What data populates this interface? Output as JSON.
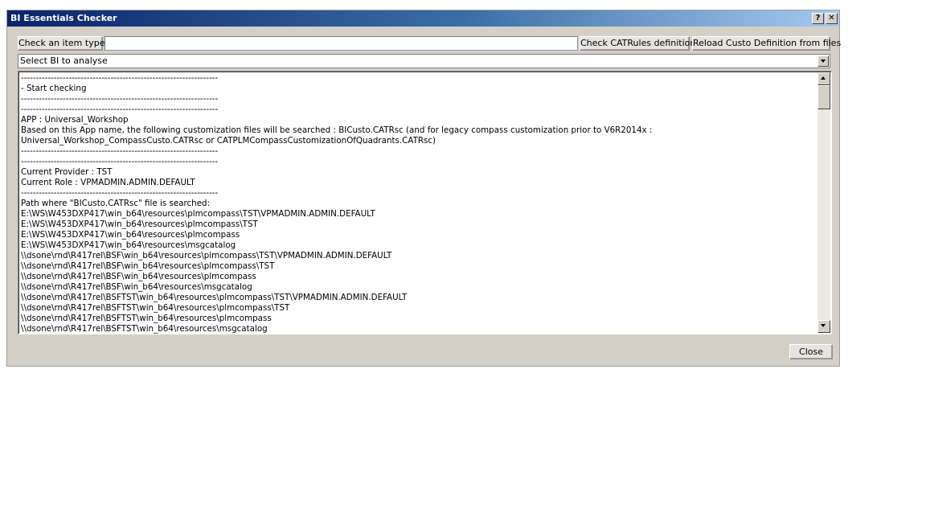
{
  "window": {
    "title": "BI Essentials Checker",
    "help_label": "?",
    "close_label": "✕"
  },
  "toolbar": {
    "check_item_type_label": "Check an item type",
    "item_type_value": "",
    "check_catrules_label": "Check CATRules definition",
    "reload_custo_label": "Reload Custo Definition from files"
  },
  "bi_select": {
    "value": "Select BI to analyse"
  },
  "log": {
    "lines": [
      "------------------------------------------------------------------",
      "- Start checking",
      "------------------------------------------------------------------",
      "------------------------------------------------------------------",
      "APP : Universal_Workshop",
      "Based on this App name, the following customization files will be searched : BICusto.CATRsc (and for legacy compass customization prior to V6R2014x : Universal_Workshop_CompassCusto.CATRsc or CATPLMCompassCustomizationOfQuadrants.CATRsc)",
      "------------------------------------------------------------------",
      "------------------------------------------------------------------",
      "Current Provider : TST",
      "Current Role : VPMADMIN.ADMIN.DEFAULT",
      "------------------------------------------------------------------",
      "Path where \"BICusto.CATRsc\" file is searched:",
      "E:\\WS\\W453DXP417\\win_b64\\resources\\plmcompass\\TST\\VPMADMIN.ADMIN.DEFAULT",
      "E:\\WS\\W453DXP417\\win_b64\\resources\\plmcompass\\TST",
      "E:\\WS\\W453DXP417\\win_b64\\resources\\plmcompass",
      "E:\\WS\\W453DXP417\\win_b64\\resources\\msgcatalog",
      "\\\\dsone\\rnd\\R417rel\\BSF\\win_b64\\resources\\plmcompass\\TST\\VPMADMIN.ADMIN.DEFAULT",
      "\\\\dsone\\rnd\\R417rel\\BSF\\win_b64\\resources\\plmcompass\\TST",
      "\\\\dsone\\rnd\\R417rel\\BSF\\win_b64\\resources\\plmcompass",
      "\\\\dsone\\rnd\\R417rel\\BSF\\win_b64\\resources\\msgcatalog",
      "\\\\dsone\\rnd\\R417rel\\BSFTST\\win_b64\\resources\\plmcompass\\TST\\VPMADMIN.ADMIN.DEFAULT",
      "\\\\dsone\\rnd\\R417rel\\BSFTST\\win_b64\\resources\\plmcompass\\TST",
      "\\\\dsone\\rnd\\R417rel\\BSFTST\\win_b64\\resources\\plmcompass",
      "\\\\dsone\\rnd\\R417rel\\BSFTST\\win_b64\\resources\\msgcatalog"
    ]
  },
  "footer": {
    "close_label": "Close"
  }
}
